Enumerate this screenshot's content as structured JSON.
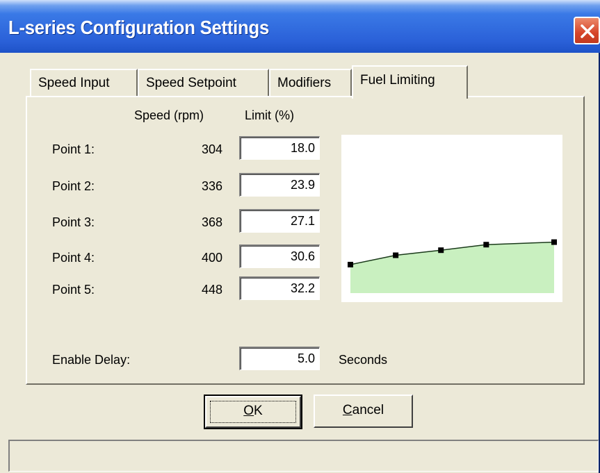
{
  "window": {
    "title": "L-series Configuration Settings"
  },
  "tabs": [
    {
      "label": "Speed Input",
      "active": false
    },
    {
      "label": "Speed Setpoint",
      "active": false
    },
    {
      "label": "Modifiers",
      "active": false
    },
    {
      "label": "Fuel Limiting",
      "active": true
    }
  ],
  "fuel_limiting": {
    "col_speed": "Speed (rpm)",
    "col_limit": "Limit (%)",
    "points": [
      {
        "label": "Point 1:",
        "speed": "304",
        "limit": "18.0"
      },
      {
        "label": "Point 2:",
        "speed": "336",
        "limit": "23.9"
      },
      {
        "label": "Point 3:",
        "speed": "368",
        "limit": "27.1"
      },
      {
        "label": "Point 4:",
        "speed": "400",
        "limit": "30.6"
      },
      {
        "label": "Point 5:",
        "speed": "448",
        "limit": "32.2"
      }
    ],
    "enable_delay_label": "Enable Delay:",
    "enable_delay_value": "5.0",
    "enable_delay_unit": "Seconds"
  },
  "buttons": {
    "ok": {
      "mnemonic": "O",
      "rest": "K"
    },
    "cancel": {
      "mnemonic": "C",
      "rest": "ancel"
    }
  },
  "status_bar": {
    "text": ""
  },
  "chart_data": {
    "type": "area",
    "x": [
      304,
      336,
      368,
      400,
      448
    ],
    "y": [
      18.0,
      23.9,
      27.1,
      30.6,
      32.2
    ],
    "xlim": [
      304,
      448
    ],
    "ylim": [
      0,
      100
    ],
    "fill_color": "#c9f0c0",
    "line_color": "#1a3a1a",
    "marker_color": "#000000"
  },
  "colors": {
    "title_bar": "#2a60d8",
    "close_button": "#d6452a",
    "face": "#ece9d8"
  }
}
